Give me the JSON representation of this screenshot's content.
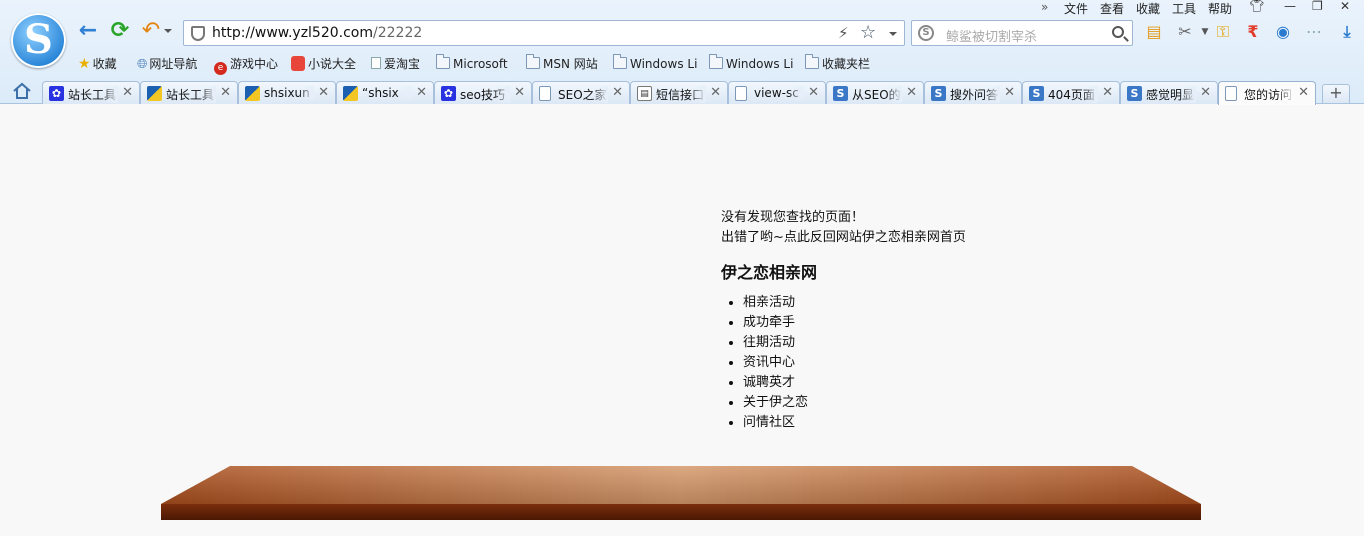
{
  "browser": {
    "menu": [
      "文件",
      "查看",
      "收藏",
      "工具",
      "帮助"
    ],
    "url_host": "http://www.yzl520.com",
    "url_path": "/22222",
    "search_placeholder": "鲸鲨被切割宰杀",
    "bookmarks": [
      "收藏",
      "网址导航",
      "游戏中心",
      "小说大全",
      "爱淘宝",
      "Microsoft",
      "MSN 网站",
      "Windows Li",
      "Windows Li",
      "收藏夹栏"
    ],
    "tabs": [
      {
        "title": "站长工具",
        "favicon": "baidu-icon"
      },
      {
        "title": "站长工具",
        "favicon": "chinaz-icon"
      },
      {
        "title": "shsixun",
        "favicon": "chinaz-icon"
      },
      {
        "title": "“shsix",
        "favicon": "chinaz-icon"
      },
      {
        "title": "seo技巧",
        "favicon": "baidu-icon"
      },
      {
        "title": "SEO之家",
        "favicon": "page-icon"
      },
      {
        "title": "短信接口",
        "favicon": "sms-icon"
      },
      {
        "title": "view-sc",
        "favicon": "page-icon"
      },
      {
        "title": "从SEO的",
        "favicon": "sogou-icon"
      },
      {
        "title": "搜外问答",
        "favicon": "sogou-icon"
      },
      {
        "title": "404页面",
        "favicon": "sogou-icon"
      },
      {
        "title": "感觉明显",
        "favicon": "sogou-icon"
      },
      {
        "title": "您的访问",
        "favicon": "page-icon",
        "active": true
      }
    ]
  },
  "page": {
    "error_title": "没有发现您查找的页面！",
    "error_link_line": "出错了哟~点此反回网站伊之恋相亲网首页",
    "site_title": "伊之恋相亲网",
    "nav_items": [
      "相亲活动",
      "成功牵手",
      "往期活动",
      "资讯中心",
      "诚聘英才",
      "关于伊之恋",
      "问情社区"
    ]
  }
}
